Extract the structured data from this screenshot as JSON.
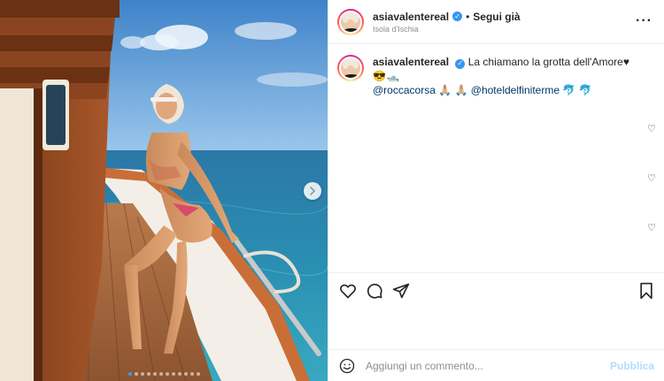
{
  "post": {
    "username": "asiavalentereal",
    "follow_label": "Segui già",
    "separator": "•",
    "location": "Isola d'Ischia",
    "more_icon": "more-horizontal-icon",
    "verified_icon": "verified-badge-icon"
  },
  "caption": {
    "username": "asiavalentereal",
    "text": "La chiamano la grotta dell'Amore",
    "emojis": "♥😎🛥️",
    "mention_1": "@roccacorsa",
    "emoji_mid": "🙏🏼 🙏🏼",
    "mention_2": "@hoteldelfiniterme",
    "emoji_end": "🐬 🐬"
  },
  "comment_hearts": [
    "♡",
    "♡",
    "♡"
  ],
  "actions": {
    "like_icon": "heart-icon",
    "comment_icon": "comment-icon",
    "share_icon": "share-icon",
    "save_icon": "bookmark-icon"
  },
  "add_comment": {
    "placeholder": "Aggiungi un commento...",
    "post_label": "Pubblica",
    "emoji_icon": "smiley-icon"
  },
  "carousel": {
    "total": 12,
    "current": 1,
    "next_icon": "chevron-right-icon"
  },
  "colors": {
    "accent": "#3897f0",
    "link": "#00376b",
    "publish_disabled": "#b3dbff"
  }
}
